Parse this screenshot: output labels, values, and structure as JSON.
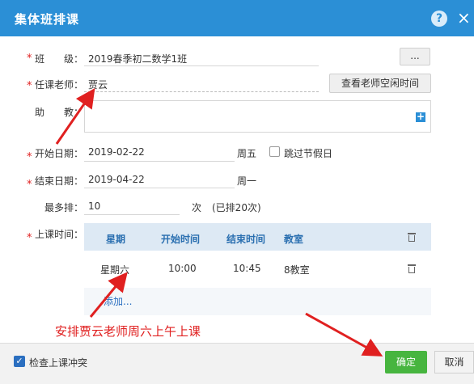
{
  "dialog": {
    "title": "集体班排课",
    "help": "?",
    "close": "×"
  },
  "form": {
    "class_label": "班　　级：",
    "class_value": "2019春季初二数学1班",
    "class_browse_button": "...",
    "teacher_label": "任课老师：",
    "teacher_value": "贾云",
    "teacher_free_time_button": "查看老师空闲时间",
    "assistant_label": "助　　教：",
    "assistant_value": "",
    "start_date_label": "开始日期：",
    "start_date_value": "2019-02-22",
    "start_weekday": "周五",
    "skip_holidays_label": "跳过节假日",
    "end_date_label": "结束日期：",
    "end_date_value": "2019-04-22",
    "end_weekday": "周一",
    "max_label": "最多排：",
    "max_value": "10",
    "max_unit": "次",
    "max_note": "(已排20次)",
    "schedule_label": "上课时间：",
    "required_mark": "*"
  },
  "schedule_table": {
    "headers": [
      "星期",
      "开始时间",
      "结束时间",
      "教室"
    ],
    "rows": [
      {
        "weekday": "星期六",
        "start": "10:00",
        "end": "10:45",
        "room": "8教室"
      }
    ],
    "add_link": "添加..."
  },
  "annotation": {
    "text": "安排贾云老师周六上午上课",
    "color": "#e02020"
  },
  "footer": {
    "check_conflict_label": "检查上课冲突",
    "check_conflict_checked": true,
    "ok_button": "确定",
    "cancel_button": "取消"
  },
  "colors": {
    "header_blue": "#2b8fd6",
    "ok_green": "#47b53f",
    "required_red": "#e02020"
  }
}
